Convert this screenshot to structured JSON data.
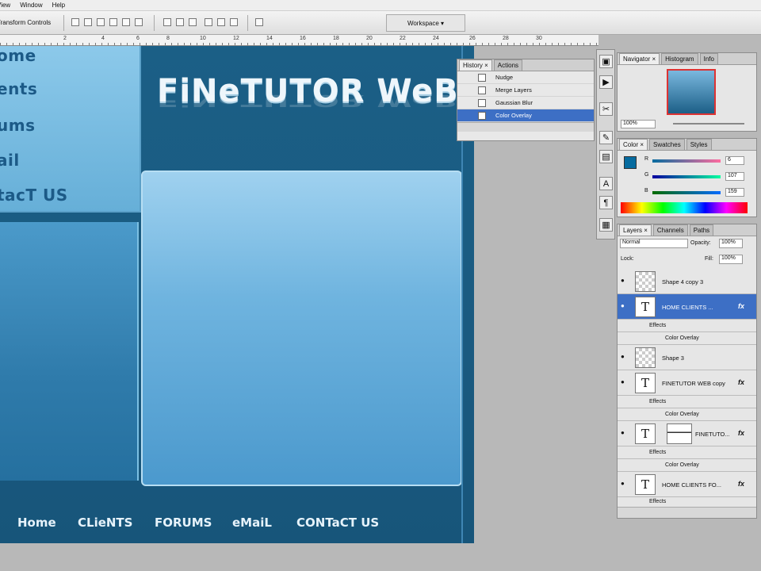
{
  "menubar": {
    "items": [
      "View",
      "Window",
      "Help"
    ]
  },
  "options": {
    "transform_label": "Transform Controls",
    "workspace_label": "Workspace ▾"
  },
  "ruler": {
    "numbers": [
      "2",
      "4",
      "6",
      "8",
      "10",
      "12",
      "14",
      "16",
      "18",
      "20",
      "22",
      "24",
      "26",
      "28",
      "30"
    ]
  },
  "canvas": {
    "nav_items": [
      "ome",
      "ents",
      "ums",
      "ail",
      "tacT US"
    ],
    "title": "FiNeTUTOR WeB",
    "bottom_nav": [
      "Home",
      "CLieNTS",
      "FORUMS",
      "eMaiL",
      "CONTaCT US"
    ]
  },
  "history": {
    "tabs": [
      "History ×",
      "Actions"
    ],
    "rows": [
      "Nudge",
      "Merge Layers",
      "Gaussian Blur",
      "Color Overlay"
    ],
    "selected_index": 3
  },
  "navigator": {
    "tabs": [
      "Navigator ×",
      "Histogram",
      "Info"
    ],
    "zoom": "100%"
  },
  "color": {
    "tabs": [
      "Color ×",
      "Swatches",
      "Styles"
    ],
    "r_label": "R",
    "g_label": "G",
    "b_label": "B",
    "r": "6",
    "g": "107",
    "b": "159",
    "fg_color": "#066b9f"
  },
  "layers": {
    "tabs": [
      "Layers ×",
      "Channels",
      "Paths"
    ],
    "blend_mode": "Normal",
    "opacity_label": "Opacity:",
    "opacity": "100%",
    "lock_label": "Lock:",
    "fill_label": "Fill:",
    "fill": "100%",
    "rows": [
      {
        "name": "Shape 4 copy 3"
      },
      {
        "name": "HOME    CLIENTS  ...",
        "effects": "Effects",
        "overlay": "Color Overlay"
      },
      {
        "name": "Shape 3"
      },
      {
        "name": "FINETUTOR WEB copy",
        "effects": "Effects",
        "overlay": "Color Overlay"
      },
      {
        "name": "FINETUTO...",
        "effects": "Effects",
        "overlay": "Color Overlay"
      },
      {
        "name": "HOME CLIENTS FO...",
        "effects": "Effects"
      }
    ],
    "fx_symbol": "fx"
  }
}
